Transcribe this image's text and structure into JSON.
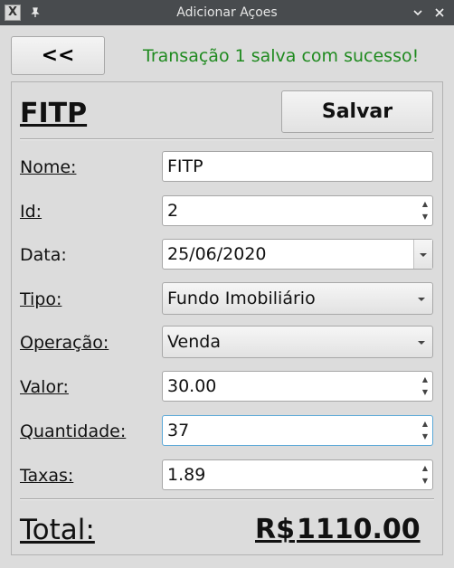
{
  "window": {
    "title": "Adicionar Açoes",
    "app_icon": "x-window-icon",
    "pin_icon": "pin-icon",
    "minimize_icon": "chevron-down-icon",
    "close_icon": "close-icon"
  },
  "toolbar": {
    "back_label": "<<",
    "status_message": "Transação 1 salva com sucesso!",
    "status_color": "#1f8a1f"
  },
  "form": {
    "stock_title": "FITP",
    "save_label": "Salvar",
    "fields": {
      "nome": {
        "label": "Nome:",
        "value": "FITP"
      },
      "id": {
        "label": "Id:",
        "value": "2"
      },
      "data": {
        "label": "Data:",
        "value": "25/06/2020"
      },
      "tipo": {
        "label": "Tipo:",
        "value": "Fundo Imobiliário"
      },
      "operacao": {
        "label": "Operação:",
        "value": "Venda"
      },
      "valor": {
        "label": "Valor:",
        "value": "30.00"
      },
      "quantidade": {
        "label": "Quantidade:",
        "value": "37"
      },
      "taxas": {
        "label": "Taxas:",
        "value": "1.89"
      }
    },
    "total": {
      "label": "Total:",
      "currency": "R$",
      "value": "1110.00"
    }
  }
}
